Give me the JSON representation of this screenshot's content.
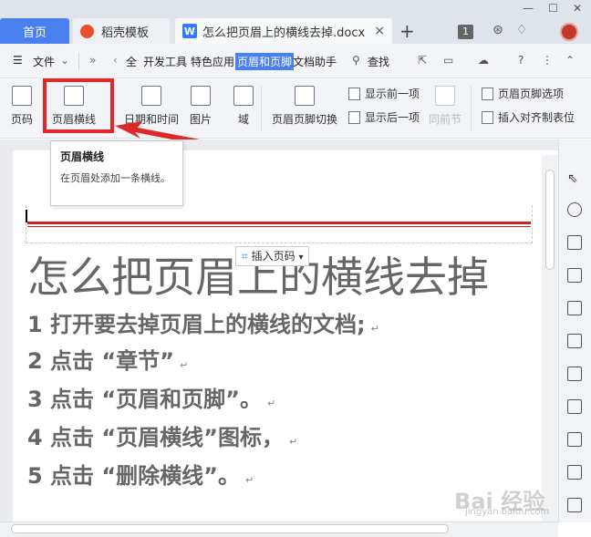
{
  "tabs": {
    "home": "首页",
    "template": "稻壳模板",
    "document": "怎么把页眉上的横线去掉.docx",
    "document_icon": "W",
    "close": "×",
    "new_tab": "+"
  },
  "window": {
    "minimize": "—",
    "maximize": "☐",
    "close": "✕",
    "badge": "1"
  },
  "menu": {
    "hamburger": "☰",
    "file": "文件",
    "more": "»",
    "items": [
      "全",
      "开发工具",
      "特色应用",
      "页眉和页脚",
      "文档助手"
    ],
    "search": "查找",
    "help": "?"
  },
  "ribbon": {
    "page_number": "页码",
    "header_line": "页眉横线",
    "date_time": "日期和时间",
    "picture": "图片",
    "field": "域",
    "header_footer_switch": "页眉页脚切换",
    "show_previous": "显示前一项",
    "show_next": "显示后一项",
    "same_as_previous": "同前节",
    "header_footer_options": "页眉页脚选项",
    "insert_alignment_tab": "插入对齐制表位"
  },
  "tooltip": {
    "title": "页眉横线",
    "description": "在页眉处添加一条横线。"
  },
  "document": {
    "insert_page_number": "插入页码",
    "title": "怎么把页眉上的横线去掉",
    "steps": [
      "1 打开要去掉页眉上的横线的文档;",
      "2 点击 “章节”",
      "3 点击 “页眉和页脚”。",
      "4 点击 “页眉横线”图标，",
      "5 点击 “删除横线”。"
    ]
  },
  "watermark": "Bai 经验",
  "watermark_url": "jingyan.baidu.com",
  "colors": {
    "accent": "#4a7ff0",
    "highlight": "#e02828",
    "header_line": "#d02020"
  }
}
